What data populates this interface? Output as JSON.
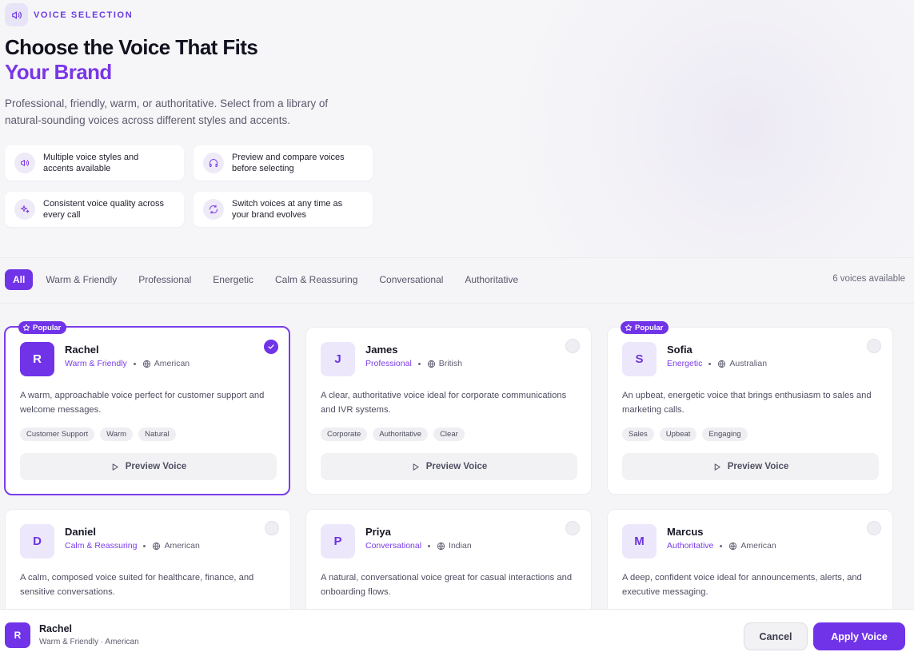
{
  "header": {
    "eyebrow": "VOICE SELECTION",
    "title_line1": "Choose the Voice That Fits",
    "title_line2": "Your Brand",
    "subtitle": "Professional, friendly, warm, or authoritative. Select from a library of natural-sounding voices across different styles and accents."
  },
  "features": [
    {
      "icon": "speaker-icon",
      "text": "Multiple voice styles and accents available"
    },
    {
      "icon": "headphones-icon",
      "text": "Preview and compare voices before selecting"
    },
    {
      "icon": "sparkle-icon",
      "text": "Consistent voice quality across every call"
    },
    {
      "icon": "refresh-icon",
      "text": "Switch voices at any time as your brand evolves"
    }
  ],
  "filters": {
    "tabs": [
      "All",
      "Warm & Friendly",
      "Professional",
      "Energetic",
      "Calm & Reassuring",
      "Conversational",
      "Authoritative"
    ],
    "active": "All",
    "count": "6 voices available"
  },
  "voices": [
    {
      "initial": "R",
      "name": "Rachel",
      "style": "Warm & Friendly",
      "accent": "American",
      "popular": true,
      "selected": true,
      "description": "A warm, approachable voice perfect for customer support and welcome messages.",
      "tags": [
        "Customer Support",
        "Warm",
        "Natural"
      ]
    },
    {
      "initial": "J",
      "name": "James",
      "style": "Professional",
      "accent": "British",
      "popular": false,
      "selected": false,
      "description": "A clear, authoritative voice ideal for corporate communications and IVR systems.",
      "tags": [
        "Corporate",
        "Authoritative",
        "Clear"
      ]
    },
    {
      "initial": "S",
      "name": "Sofia",
      "style": "Energetic",
      "accent": "Australian",
      "popular": true,
      "selected": false,
      "description": "An upbeat, energetic voice that brings enthusiasm to sales and marketing calls.",
      "tags": [
        "Sales",
        "Upbeat",
        "Engaging"
      ]
    },
    {
      "initial": "D",
      "name": "Daniel",
      "style": "Calm & Reassuring",
      "accent": "American",
      "popular": false,
      "selected": false,
      "description": "A calm, composed voice suited for healthcare, finance, and sensitive conversations.",
      "tags": []
    },
    {
      "initial": "P",
      "name": "Priya",
      "style": "Conversational",
      "accent": "Indian",
      "popular": false,
      "selected": false,
      "description": "A natural, conversational voice great for casual interactions and onboarding flows.",
      "tags": []
    },
    {
      "initial": "M",
      "name": "Marcus",
      "style": "Authoritative",
      "accent": "American",
      "popular": false,
      "selected": false,
      "description": "A deep, confident voice ideal for announcements, alerts, and executive messaging.",
      "tags": []
    }
  ],
  "labels": {
    "popular_badge": "Popular",
    "preview_button": "Preview Voice"
  },
  "footer": {
    "initial": "R",
    "name": "Rachel",
    "meta": "Warm & Friendly · American",
    "cancel": "Cancel",
    "apply": "Apply Voice"
  },
  "colors": {
    "accent": "#7033e8",
    "accent_text": "#7a3ce8"
  }
}
